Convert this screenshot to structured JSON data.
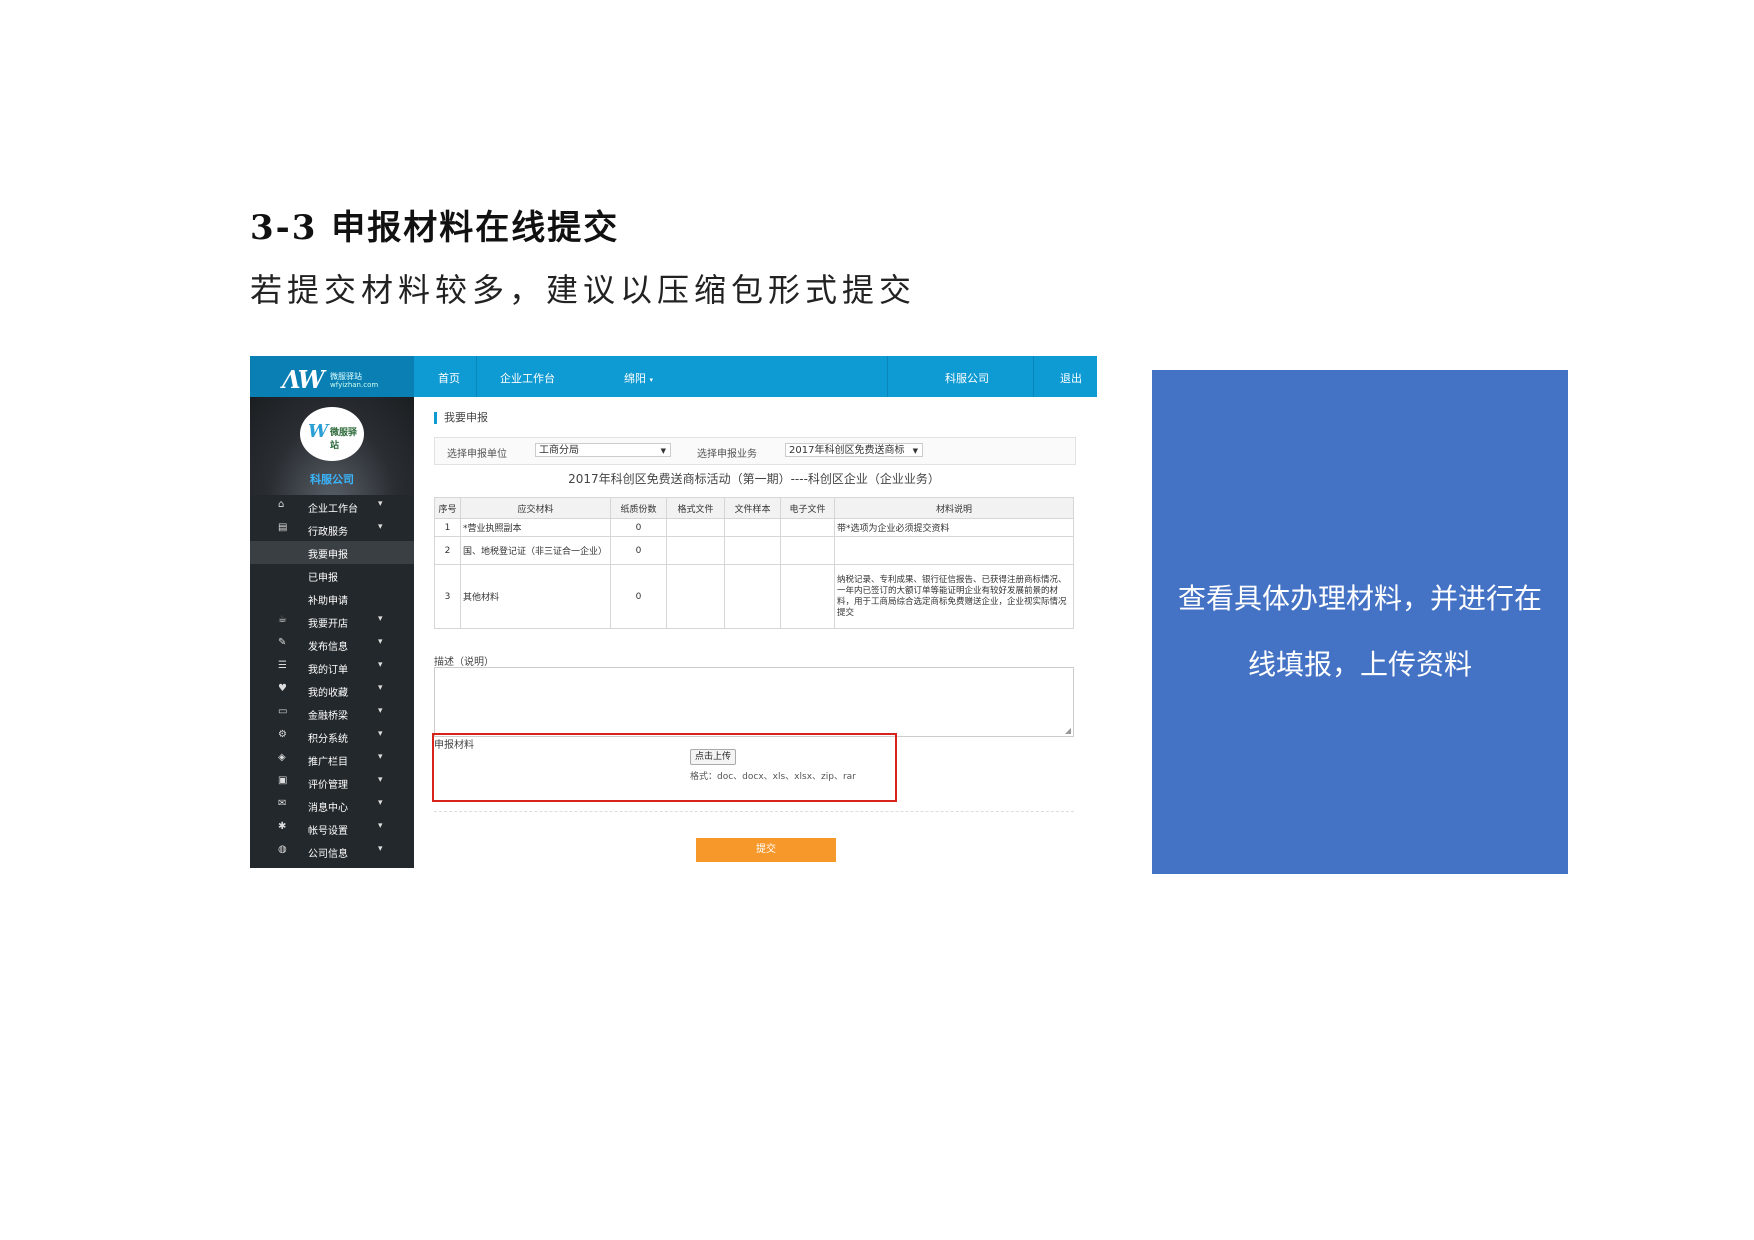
{
  "doc": {
    "heading": "3-3 申报材料在线提交",
    "subtitle": "若提交材料较多，建议以压缩包形式提交"
  },
  "topbar": {
    "logo_mark": "W",
    "logo_name": "微服驿站",
    "logo_url": "wfyizhan.com",
    "nav": [
      "首页",
      "企业工作台",
      "绵阳"
    ],
    "company_link": "科服公司",
    "logout": "退出"
  },
  "sidebar": {
    "avatar_text": "微服驿站",
    "company": "科服公司",
    "items": [
      {
        "label": "企业工作台",
        "icon": "home-icon"
      },
      {
        "label": "行政服务",
        "icon": "document-icon"
      },
      {
        "label": "我要申报",
        "icon": ""
      },
      {
        "label": "已申报",
        "icon": ""
      },
      {
        "label": "补助申请",
        "icon": ""
      },
      {
        "label": "我要开店",
        "icon": "shop-icon"
      },
      {
        "label": "发布信息",
        "icon": "pencil-icon"
      },
      {
        "label": "我的订单",
        "icon": "list-icon"
      },
      {
        "label": "我的收藏",
        "icon": "heart-icon"
      },
      {
        "label": "金融桥梁",
        "icon": "card-icon"
      },
      {
        "label": "积分系统",
        "icon": "gear-icon"
      },
      {
        "label": "推广栏目",
        "icon": "cube-icon"
      },
      {
        "label": "评价管理",
        "icon": "comment-icon"
      },
      {
        "label": "消息中心",
        "icon": "mail-icon"
      },
      {
        "label": "帐号设置",
        "icon": "settings-icon"
      },
      {
        "label": "公司信息",
        "icon": "globe-icon"
      }
    ]
  },
  "main": {
    "breadcrumb": "我要申报",
    "filter": {
      "unit_label": "选择申报单位",
      "unit_value": "工商分局",
      "business_label": "选择申报业务",
      "business_value": "2017年科创区免费送商标"
    },
    "form_title": "2017年科创区免费送商标活动（第一期）----科创区企业（企业业务）",
    "table": {
      "headers": [
        "序号",
        "应交材料",
        "纸质份数",
        "格式文件",
        "文件样本",
        "电子文件",
        "材料说明"
      ],
      "rows": [
        {
          "no": "1",
          "name": "*营业执照副本",
          "copies": "0",
          "note": "带*选项为企业必须提交资料"
        },
        {
          "no": "2",
          "name": "国、地税登记证（非三证合一企业）",
          "copies": "0",
          "note": ""
        },
        {
          "no": "3",
          "name": "其他材料",
          "copies": "0",
          "note": "纳税记录、专利成果、银行征信报告、已获得注册商标情况、一年内已签订的大额订单等能证明企业有较好发展前景的材料，用于工商局综合选定商标免费赠送企业，企业视实际情况提交"
        }
      ]
    },
    "desc_label": "描述（说明）",
    "upload_label": "申报材料",
    "upload_button": "点击上传",
    "upload_formats": "格式：doc、docx、xls、xlsx、zip、rar",
    "submit": "提交"
  },
  "callout": {
    "line1": "查看具体办理材料，并进行在",
    "line2": "线填报，上传资料",
    "color": "#4472c4"
  }
}
